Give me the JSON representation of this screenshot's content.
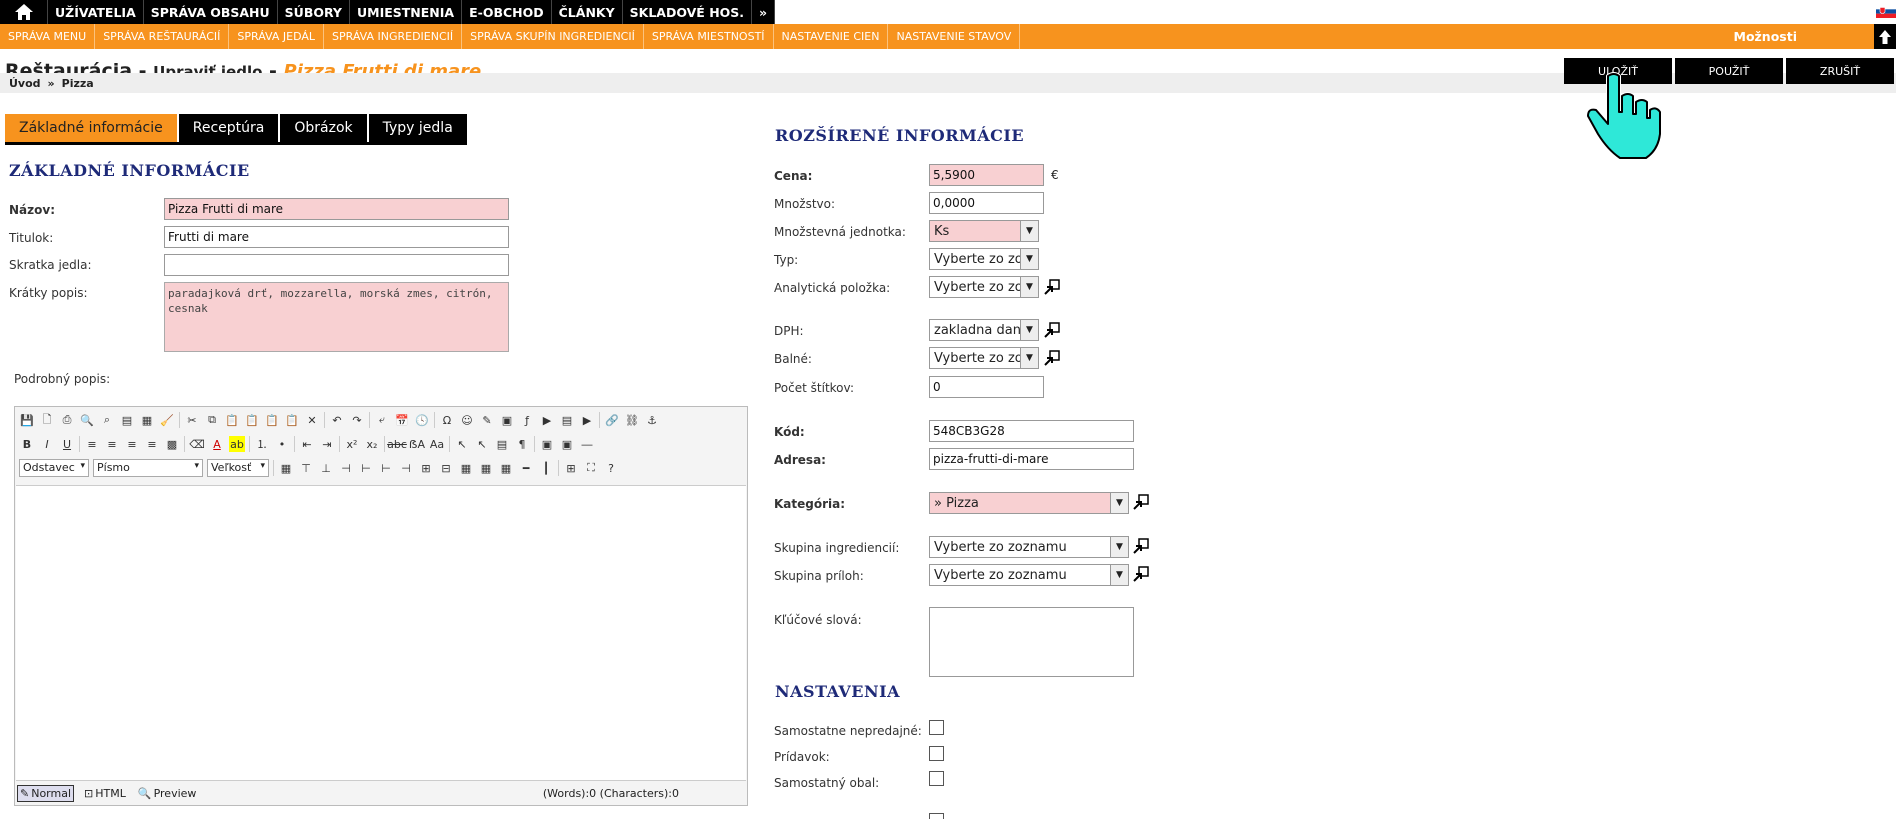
{
  "topnav": {
    "items": [
      "UŽÍVATELIA",
      "SPRÁVA OBSAHU",
      "SÚBORY",
      "UMIESTNENIA",
      "E-OBCHOD",
      "ČLÁNKY",
      "SKLADOVÉ HOS.",
      "»"
    ]
  },
  "subnav": {
    "items": [
      "SPRÁVA MENU",
      "SPRÁVA REŠTAURÁCIÍ",
      "SPRÁVA JEDÁL",
      "SPRÁVA INGREDIENCIÍ",
      "SPRÁVA SKUPÍN INGREDIENCIÍ",
      "SPRÁVA MIESTNOSTÍ",
      "NASTAVENIE CIEN",
      "NASTAVENIE STAVOV"
    ],
    "options_label": "Možnosti"
  },
  "page": {
    "module": "Reštaurácia",
    "dash": " - ",
    "action": "Upraviť jedlo",
    "dash2": " - ",
    "dish": "Pizza Frutti di mare"
  },
  "actions": {
    "save": "ULOŽIŤ",
    "apply": "POUŽIŤ",
    "cancel": "ZRUŠIŤ"
  },
  "breadcrumb": {
    "home": "Úvod",
    "sep": "»",
    "current": "Pizza"
  },
  "tabs": [
    "Základné informácie",
    "Receptúra",
    "Obrázok",
    "Typy jedla"
  ],
  "basic": {
    "heading": "ZÁKLADNÉ INFORMÁCIE",
    "name_label": "Názov:",
    "name_value": "Pizza Frutti di mare",
    "title_label": "Titulok:",
    "title_value": "Frutti di mare",
    "abbr_label": "Skratka jedla:",
    "abbr_value": "",
    "short_label": "Krátky popis:",
    "short_value": "paradajková drť, mozzarella, morská zmes, citrón, cesnak",
    "detail_label": "Podrobný popis:"
  },
  "editor": {
    "format": "Odstavec",
    "font": "Písmo",
    "size": "Veľkosť",
    "modes": [
      "Normal",
      "HTML",
      "Preview"
    ],
    "count": "(Words):0 (Characters):0"
  },
  "extended": {
    "heading": "ROZŠÍRENÉ INFORMÁCIE",
    "price_label": "Cena:",
    "price_value": "5,5900",
    "currency": "€",
    "qty_label": "Množstvo:",
    "qty_value": "0,0000",
    "unit_label": "Množstevná jednotka:",
    "unit_value": "Ks",
    "type_label": "Typ:",
    "type_value": "Vyberte zo zo",
    "analytic_label": "Analytická položka:",
    "analytic_value": "Vyberte zo zo",
    "vat_label": "DPH:",
    "vat_value": "zakladna dan",
    "packing_label": "Balné:",
    "packing_value": "Vyberte zo zo",
    "labels_label": "Počet štítkov:",
    "labels_value": "0",
    "code_label": "Kód:",
    "code_value": "548CB3G28",
    "address_label": "Adresa:",
    "address_value": "pizza-frutti-di-mare",
    "category_label": "Kategória:",
    "category_value": "» Pizza",
    "ingr_group_label": "Skupina ingrediencií:",
    "ingr_group_value": "Vyberte zo zoznamu",
    "side_group_label": "Skupina príloh:",
    "side_group_value": "Vyberte zo zoznamu",
    "keywords_label": "Kľúčové slová:"
  },
  "settings": {
    "heading": "NASTAVENIA",
    "separately_unsellable": "Samostatne nepredajné:",
    "addon": "Prídavok:",
    "separate_pack": "Samostatný obal:"
  },
  "colors": {
    "accent": "#f7931e",
    "heading": "#1e2a78",
    "required": "#f8d0d2"
  }
}
